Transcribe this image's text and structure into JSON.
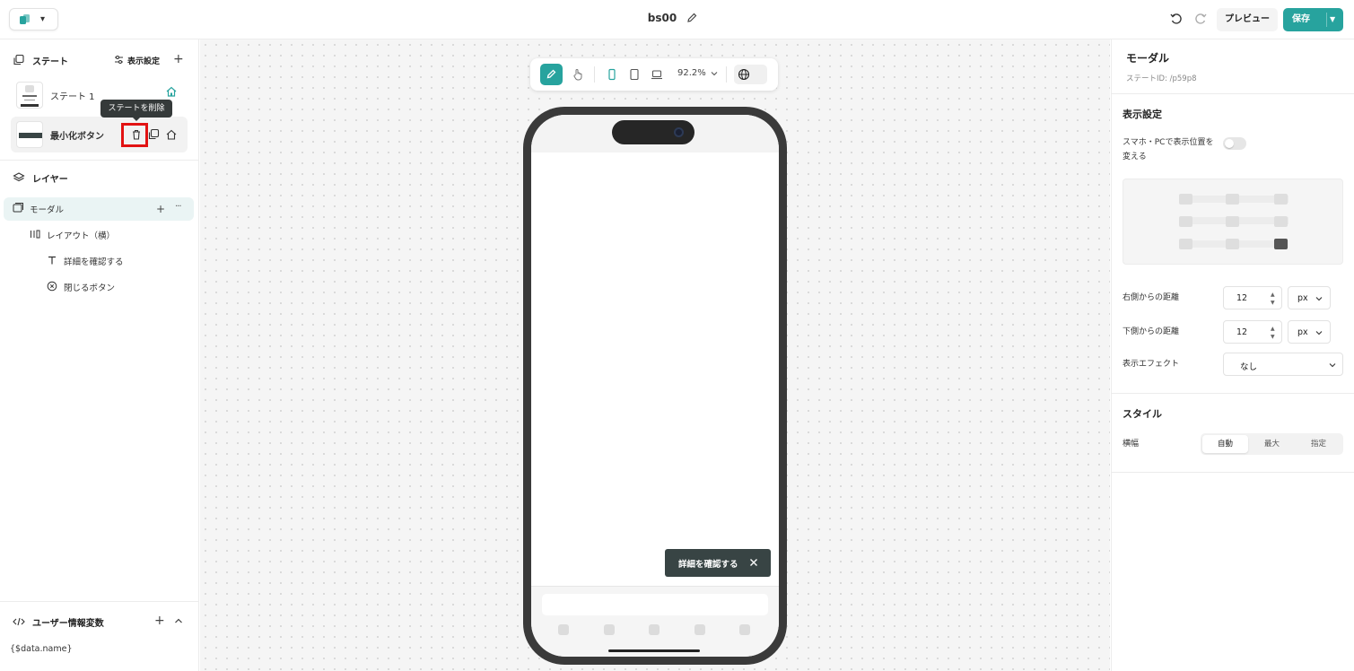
{
  "header": {
    "doc_title": "bs00",
    "preview_label": "プレビュー",
    "save_label": "保存"
  },
  "states": {
    "section_title": "ステート",
    "display_settings_label": "表示設定",
    "items": [
      {
        "label": "ステート 1",
        "is_home": true
      },
      {
        "label": "最小化ボタン",
        "is_home": false
      }
    ],
    "tooltip": "ステートを削除"
  },
  "layers": {
    "section_title": "レイヤー",
    "items": [
      {
        "label": "モーダル",
        "icon": "modal-icon"
      },
      {
        "label": "レイアウト（横）",
        "icon": "columns-icon"
      },
      {
        "label": "詳細を確認する",
        "icon": "text-icon"
      },
      {
        "label": "閉じるボタン",
        "icon": "close-circle-icon"
      }
    ]
  },
  "variables": {
    "section_title": "ユーザー情報変数",
    "items": [
      "{$data.name}"
    ]
  },
  "canvas": {
    "zoom": "92.2%",
    "modal_button_text": "詳細を確認する"
  },
  "panel": {
    "title": "モーダル",
    "state_id": "ステートID: /p59p8",
    "display_section": "表示設定",
    "responsive_label": "スマホ・PCで表示位置を変える",
    "responsive_enabled": false,
    "position_selected": "bottom-right",
    "right_distance_label": "右側からの距離",
    "right_distance_value": "12",
    "right_distance_unit": "px",
    "bottom_distance_label": "下側からの距離",
    "bottom_distance_value": "12",
    "bottom_distance_unit": "px",
    "effect_label": "表示エフェクト",
    "effect_value": "なし",
    "style_section": "スタイル",
    "width_label": "横幅",
    "width_options": [
      "自動",
      "最大",
      "指定"
    ],
    "width_selected": "自動"
  },
  "colors": {
    "accent": "#27a39e",
    "highlight": "#e21212",
    "modal_button": "#384444"
  }
}
